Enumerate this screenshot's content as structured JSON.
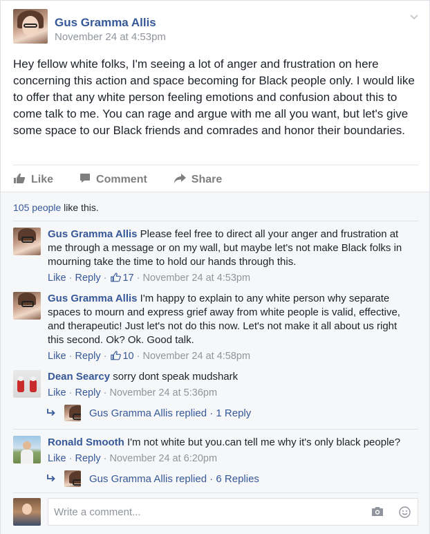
{
  "post": {
    "author": "Gus Gramma Allis",
    "timestamp": "November 24 at 4:53pm",
    "text": "Hey fellow white folks, I'm seeing a lot of anger and frustration on here concerning this action and space becoming for Black people only. I would like to offer that any white person feeling emotions and confusion about this to come talk to me. You can rage and argue with me all you want, but let's give some space to our Black friends and comrades and honor their boundaries.",
    "actions": {
      "like": "Like",
      "comment": "Comment",
      "share": "Share"
    },
    "likes_count": "105 people",
    "likes_suffix": " like this."
  },
  "comments": [
    {
      "author": "Gus Gramma Allis",
      "text": " Please feel free to direct all your anger and frustration at me through a message or on my wall, but maybe let's not make Black folks in mourning take the time to hold our hands through this.",
      "like": "Like",
      "reply": "Reply",
      "like_count": "17",
      "timestamp": "November 24 at 4:53pm"
    },
    {
      "author": "Gus Gramma Allis",
      "text": " I'm happy to explain to any white person why separate spaces to mourn and express grief away from white people is valid, effective, and therapeutic! Just let's not do this now. Let's not make it all about us right this second. Ok? Ok. Good talk.",
      "like": "Like",
      "reply": "Reply",
      "like_count": "10",
      "timestamp": "November 24 at 4:58pm"
    },
    {
      "author": "Dean Searcy",
      "text": " sorry dont speak mudshark",
      "like": "Like",
      "reply": "Reply",
      "timestamp": "November 24 at 5:36pm",
      "replies": "Gus Gramma Allis replied · 1 Reply"
    },
    {
      "author": "Ronald Smooth",
      "text": " I'm not white but you.can tell me why it's only black people?",
      "like": "Like",
      "reply": "Reply",
      "timestamp": "November 24 at 6:20pm",
      "replies": "Gus Gramma Allis replied · 6 Replies"
    }
  ],
  "composer": {
    "placeholder": "Write a comment..."
  },
  "icons": {
    "chevron": "chevron-down-icon",
    "like": "thumbs-up-icon",
    "comment": "comment-bubble-icon",
    "share": "share-arrow-icon",
    "reply_arrow": "reply-arrow-icon",
    "camera": "camera-icon",
    "emoji": "smiley-icon"
  },
  "colors": {
    "link": "#365899",
    "meta": "#90949c",
    "action": "#7f7f7f",
    "lower_bg": "#f6f7f9"
  }
}
